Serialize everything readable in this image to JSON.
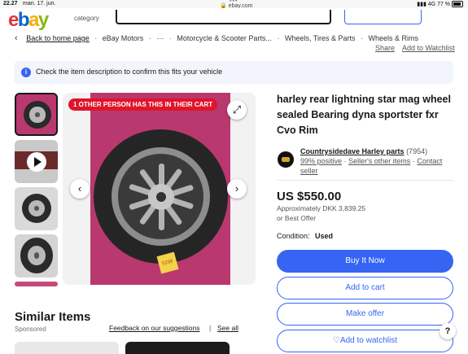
{
  "status_bar": {
    "time": "22.27",
    "date": "man. 17. jun.",
    "url": "ebay.com",
    "network": "4G",
    "battery": "77 %"
  },
  "header": {
    "logo_letters": [
      "e",
      "b",
      "a",
      "y"
    ],
    "category_label": "category"
  },
  "breadcrumb": {
    "back_label": "Back to home page",
    "items": [
      "eBay Motors",
      "···",
      "Motorcycle & Scooter Parts...",
      "Wheels, Tires & Parts",
      "Wheels & Rims"
    ]
  },
  "actions": {
    "share": "Share",
    "watchlist": "Add to Watchlist"
  },
  "banner": {
    "text": "Check the item description to confirm this fits your vehicle",
    "icon": "info-icon"
  },
  "gallery": {
    "cart_badge": "1 OTHER PERSON HAS THIS IN THEIR CART",
    "tag_text": "5298",
    "thumbnails": [
      {
        "kind": "photo",
        "selected": true
      },
      {
        "kind": "video",
        "selected": false
      },
      {
        "kind": "photo",
        "selected": false
      },
      {
        "kind": "photo",
        "selected": false
      },
      {
        "kind": "photo",
        "selected": false
      }
    ]
  },
  "listing": {
    "title": "harley rear lightning star mag wheel sealed Bearing dyna sportster fxr Cvo Rim",
    "seller_name": "Countrysidedave Harley parts",
    "seller_feedback": "(7954)",
    "positive": "99% positive",
    "other_items": "Seller's other items",
    "contact": "Contact seller",
    "price": "US $550.00",
    "approx": "Approximately DKK 3,839.25",
    "best_offer": "or Best Offer",
    "condition_label": "Condition:",
    "condition_value": "Used"
  },
  "buttons": {
    "buy": "Buy It Now",
    "cart": "Add to cart",
    "offer": "Make offer",
    "watch": "Add to watchlist",
    "help": "?"
  },
  "similar": {
    "title": "Similar Items",
    "sponsored": "Sponsored",
    "feedback": "Feedback on our suggestions",
    "separator": "|",
    "see_all": "See all"
  },
  "colors": {
    "ebay_red": "#e53238",
    "ebay_blue": "#0064d2",
    "ebay_yellow": "#f5af02",
    "ebay_green": "#86b817",
    "primary_blue": "#3665f3",
    "badge_red": "#e0142a",
    "photo_bg": "#b9386f"
  }
}
